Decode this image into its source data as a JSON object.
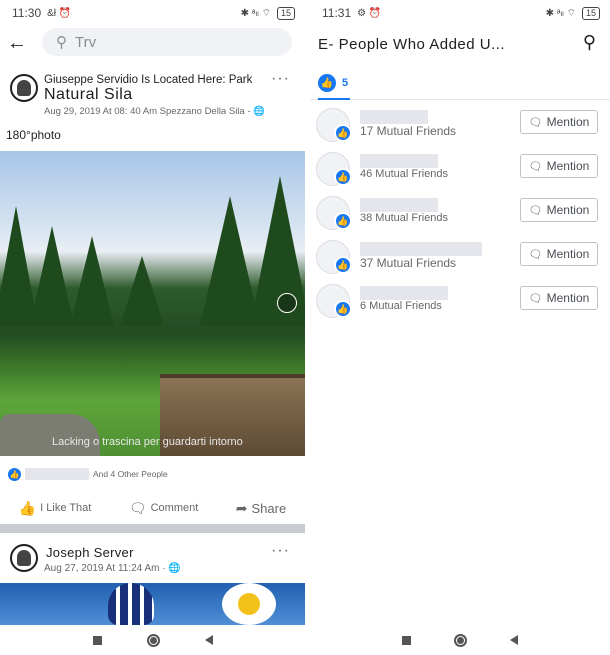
{
  "left": {
    "status": {
      "time": "11:30",
      "left_icons": "&ł ⏰",
      "right_icons": "✱ ᵃₗₗ ⌔",
      "battery": "15"
    },
    "search": {
      "placeholder": "Trv"
    },
    "post": {
      "line1": "Giuseppe Servidio Is Located Here: Park",
      "line2": "Natural Sila",
      "meta": "Aug 29, 2019 At 08: 40 Am Spezzano Della Sila -",
      "photo_label": "180°photo",
      "photo_hint": "Lacking o trascina per guardarti intorno",
      "likes_text": "And 4 Other People",
      "actions": {
        "like": "I Like That",
        "comment": "Comment",
        "share": "Share"
      }
    },
    "post2": {
      "name": "Joseph Server",
      "meta": "Aug 27, 2019 At 11:24 Am ·"
    }
  },
  "right": {
    "status": {
      "time": "11:31",
      "left_icons": "⚙ ⏰",
      "right_icons": "✱ ᵃₗₗ ⌔",
      "battery": "15"
    },
    "title": "E- People Who Added U...",
    "tab_count": "5",
    "people": [
      {
        "mutual": "17 Mutual Friends",
        "mention": "Mention"
      },
      {
        "mutual": "46 Mutual Friends",
        "mention": "Mention"
      },
      {
        "mutual": "38 Mutual Friends",
        "mention": "Mention"
      },
      {
        "mutual": "37 Mutual Friends",
        "mention": "Mention"
      },
      {
        "mutual": "6 Mutual Friends",
        "mention": "Mention"
      }
    ]
  },
  "colors": {
    "facebook_blue": "#1877f2",
    "gray_text": "#65676b"
  }
}
